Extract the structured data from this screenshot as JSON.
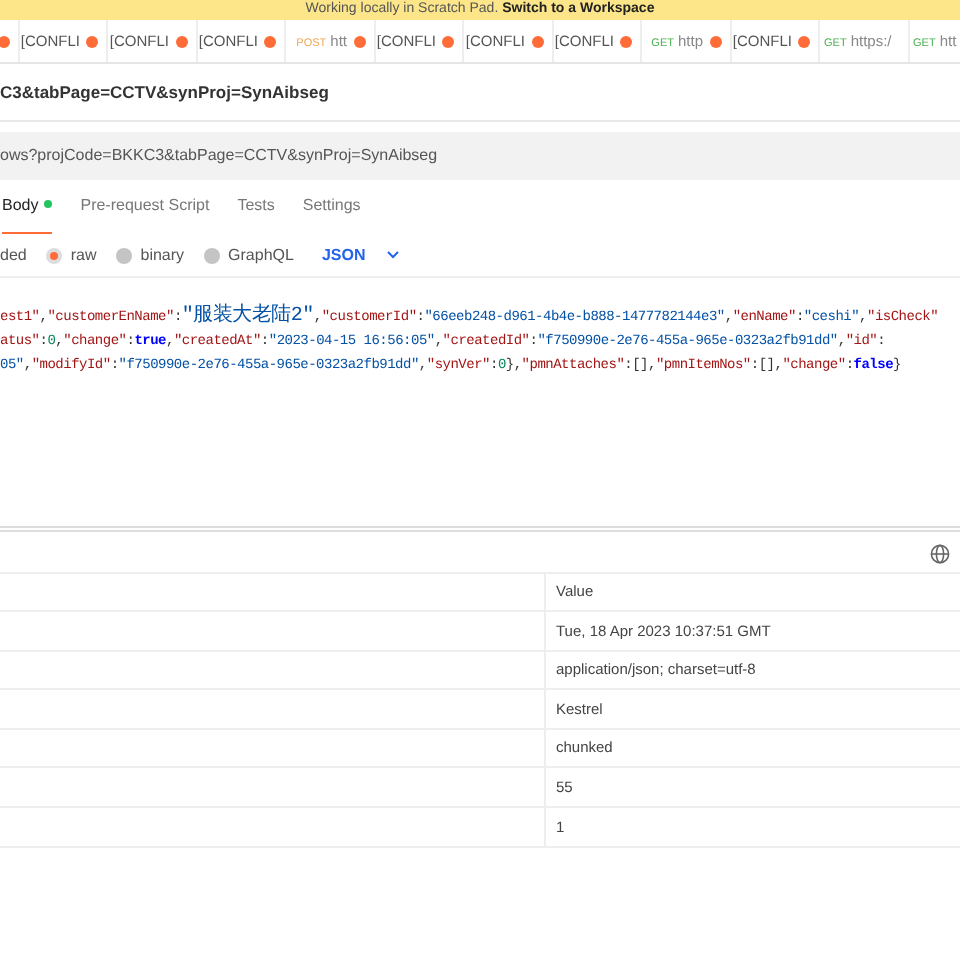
{
  "banner": {
    "text": "Working locally in Scratch Pad.",
    "link": "Switch to a Workspace"
  },
  "request_tabs": [
    {
      "kind": "conflict",
      "unsaved": true
    },
    {
      "kind": "conflict",
      "label": "[CONFLI",
      "unsaved": true
    },
    {
      "kind": "conflict",
      "label": "[CONFLI",
      "unsaved": true
    },
    {
      "kind": "conflict",
      "label": "[CONFLI",
      "unsaved": true
    },
    {
      "kind": "request",
      "method": "POST",
      "label": "htt",
      "unsaved": true
    },
    {
      "kind": "conflict",
      "label": "[CONFLI",
      "unsaved": true
    },
    {
      "kind": "conflict",
      "label": "[CONFLI",
      "unsaved": true
    },
    {
      "kind": "conflict",
      "label": "[CONFLI",
      "unsaved": true
    },
    {
      "kind": "request",
      "method": "GET",
      "label": "http",
      "unsaved": true
    },
    {
      "kind": "conflict",
      "label": "[CONFLI",
      "unsaved": true
    },
    {
      "kind": "request",
      "method": "GET",
      "label": "https:/",
      "unsaved": false
    },
    {
      "kind": "request",
      "method": "GET",
      "label": "htt",
      "unsaved": false
    }
  ],
  "request_title": "C3&tabPage=CCTV&synProj=SynAibseg",
  "url": "ows?projCode=BKKC3&tabPage=CCTV&synProj=SynAibseg",
  "editor_tabs": [
    {
      "label": "Body",
      "selected": true,
      "has_content": true
    },
    {
      "label": "Pre-request Script",
      "selected": false,
      "has_content": false
    },
    {
      "label": "Tests",
      "selected": false,
      "has_content": false
    },
    {
      "label": "Settings",
      "selected": false,
      "has_content": false
    }
  ],
  "body_types": [
    {
      "label": "ded",
      "kind": "text"
    },
    {
      "label": "raw",
      "kind": "radio",
      "selected": true
    },
    {
      "label": "binary",
      "kind": "radio",
      "selected": false
    },
    {
      "label": "GraphQL",
      "kind": "radio",
      "selected": false
    }
  ],
  "format": "JSON",
  "code_lines": [
    [
      {
        "kind": "key",
        "text": "est1\""
      },
      {
        "kind": "punct",
        "text": ","
      },
      {
        "kind": "key",
        "text": "\"customerEnName\""
      },
      {
        "kind": "punct",
        "text": ":"
      },
      {
        "kind": "cjk",
        "text": "\"服装大老陆2\""
      },
      {
        "kind": "punct",
        "text": ","
      },
      {
        "kind": "key",
        "text": "\"customerId\""
      },
      {
        "kind": "punct",
        "text": ":"
      },
      {
        "kind": "string",
        "text": "\"66eeb248-d961-4b4e-b888-1477782144e3\""
      },
      {
        "kind": "punct",
        "text": ","
      },
      {
        "kind": "key",
        "text": "\"enName\""
      },
      {
        "kind": "punct",
        "text": ":"
      },
      {
        "kind": "string",
        "text": "\"ceshi\""
      },
      {
        "kind": "punct",
        "text": ","
      },
      {
        "kind": "key",
        "text": "\"isCheck\""
      }
    ],
    [
      {
        "kind": "key",
        "text": "atus\""
      },
      {
        "kind": "punct",
        "text": ":"
      },
      {
        "kind": "number",
        "text": "0"
      },
      {
        "kind": "punct",
        "text": ","
      },
      {
        "kind": "key",
        "text": "\"change\""
      },
      {
        "kind": "punct",
        "text": ":"
      },
      {
        "kind": "bool",
        "text": "true"
      },
      {
        "kind": "punct",
        "text": ","
      },
      {
        "kind": "key",
        "text": "\"createdAt\""
      },
      {
        "kind": "punct",
        "text": ":"
      },
      {
        "kind": "string",
        "text": "\"2023-04-15 16:56:05\""
      },
      {
        "kind": "punct",
        "text": ","
      },
      {
        "kind": "key",
        "text": "\"createdId\""
      },
      {
        "kind": "punct",
        "text": ":"
      },
      {
        "kind": "string",
        "text": "\"f750990e-2e76-455a-965e-0323a2fb91dd\""
      },
      {
        "kind": "punct",
        "text": ","
      },
      {
        "kind": "key",
        "text": "\"id\""
      },
      {
        "kind": "punct",
        "text": ":"
      }
    ],
    [
      {
        "kind": "string",
        "text": "05\""
      },
      {
        "kind": "punct",
        "text": ","
      },
      {
        "kind": "key",
        "text": "\"modifyId\""
      },
      {
        "kind": "punct",
        "text": ":"
      },
      {
        "kind": "string",
        "text": "\"f750990e-2e76-455a-965e-0323a2fb91dd\""
      },
      {
        "kind": "punct",
        "text": ","
      },
      {
        "kind": "key",
        "text": "\"synVer\""
      },
      {
        "kind": "punct",
        "text": ":"
      },
      {
        "kind": "number",
        "text": "0"
      },
      {
        "kind": "punct",
        "text": "},"
      },
      {
        "kind": "key",
        "text": "\"pmnAttaches\""
      },
      {
        "kind": "punct",
        "text": ":[],"
      },
      {
        "kind": "key",
        "text": "\"pmnItemNos\""
      },
      {
        "kind": "punct",
        "text": ":[],"
      },
      {
        "kind": "key",
        "text": "\"change\""
      },
      {
        "kind": "punct",
        "text": ":"
      },
      {
        "kind": "bool",
        "text": "false"
      },
      {
        "kind": "punct",
        "text": "}"
      }
    ]
  ],
  "headers_table": {
    "columns": [
      "Value"
    ],
    "rows": [
      "Tue, 18 Apr 2023 10:37:51 GMT",
      "application/json; charset=utf-8",
      "Kestrel",
      "chunked",
      "55",
      "1"
    ]
  }
}
